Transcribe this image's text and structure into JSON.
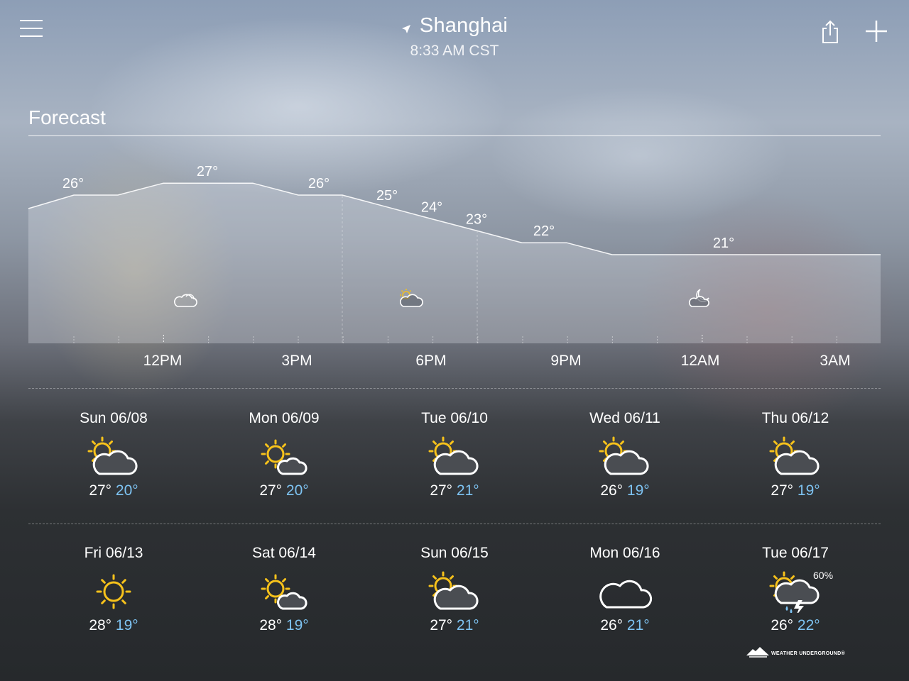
{
  "header": {
    "city": "Shanghai",
    "time": "8:33 AM CST",
    "menu_icon": "hamburger-menu-icon",
    "location_icon": "location-arrow-icon",
    "share_icon": "share-icon",
    "add_icon": "plus-icon"
  },
  "forecast": {
    "title": "Forecast",
    "hourly_temps": [
      {
        "label": "26°",
        "value": 26
      },
      {
        "label": "27°",
        "value": 27
      },
      {
        "label": "26°",
        "value": 26
      },
      {
        "label": "25°",
        "value": 25
      },
      {
        "label": "24°",
        "value": 24
      },
      {
        "label": "23°",
        "value": 23
      },
      {
        "label": "22°",
        "value": 22
      },
      {
        "label": "21°",
        "value": 21
      }
    ],
    "hour_labels": [
      "12PM",
      "3PM",
      "6PM",
      "9PM",
      "12AM",
      "3AM"
    ],
    "condition_icons": [
      "partly-cloudy-cloud-icon",
      "partly-sunny-icon",
      "night-partly-cloudy-icon"
    ]
  },
  "daily": [
    {
      "date": "Sun 06/08",
      "high": "27°",
      "low": "20°",
      "icon": "partly-cloudy-icon"
    },
    {
      "date": "Mon 06/09",
      "high": "27°",
      "low": "20°",
      "icon": "mostly-sunny-icon"
    },
    {
      "date": "Tue 06/10",
      "high": "27°",
      "low": "21°",
      "icon": "partly-cloudy-icon"
    },
    {
      "date": "Wed 06/11",
      "high": "26°",
      "low": "19°",
      "icon": "partly-cloudy-icon"
    },
    {
      "date": "Thu 06/12",
      "high": "27°",
      "low": "19°",
      "icon": "partly-cloudy-icon"
    },
    {
      "date": "Fri 06/13",
      "high": "28°",
      "low": "19°",
      "icon": "sunny-icon"
    },
    {
      "date": "Sat 06/14",
      "high": "28°",
      "low": "19°",
      "icon": "mostly-sunny-icon"
    },
    {
      "date": "Sun 06/15",
      "high": "27°",
      "low": "21°",
      "icon": "partly-cloudy-icon"
    },
    {
      "date": "Mon 06/16",
      "high": "26°",
      "low": "21°",
      "icon": "cloudy-icon"
    },
    {
      "date": "Tue 06/17",
      "high": "26°",
      "low": "22°",
      "icon": "thunderstorm-icon",
      "precip": "60%"
    }
  ],
  "footer": {
    "logo_text": "WEATHER UNDERGROUND®",
    "logo_icon": "weather-underground-logo-icon"
  },
  "colors": {
    "low_temp": "#7ec3f2",
    "sun": "#f7c21b",
    "text": "#ffffff"
  }
}
